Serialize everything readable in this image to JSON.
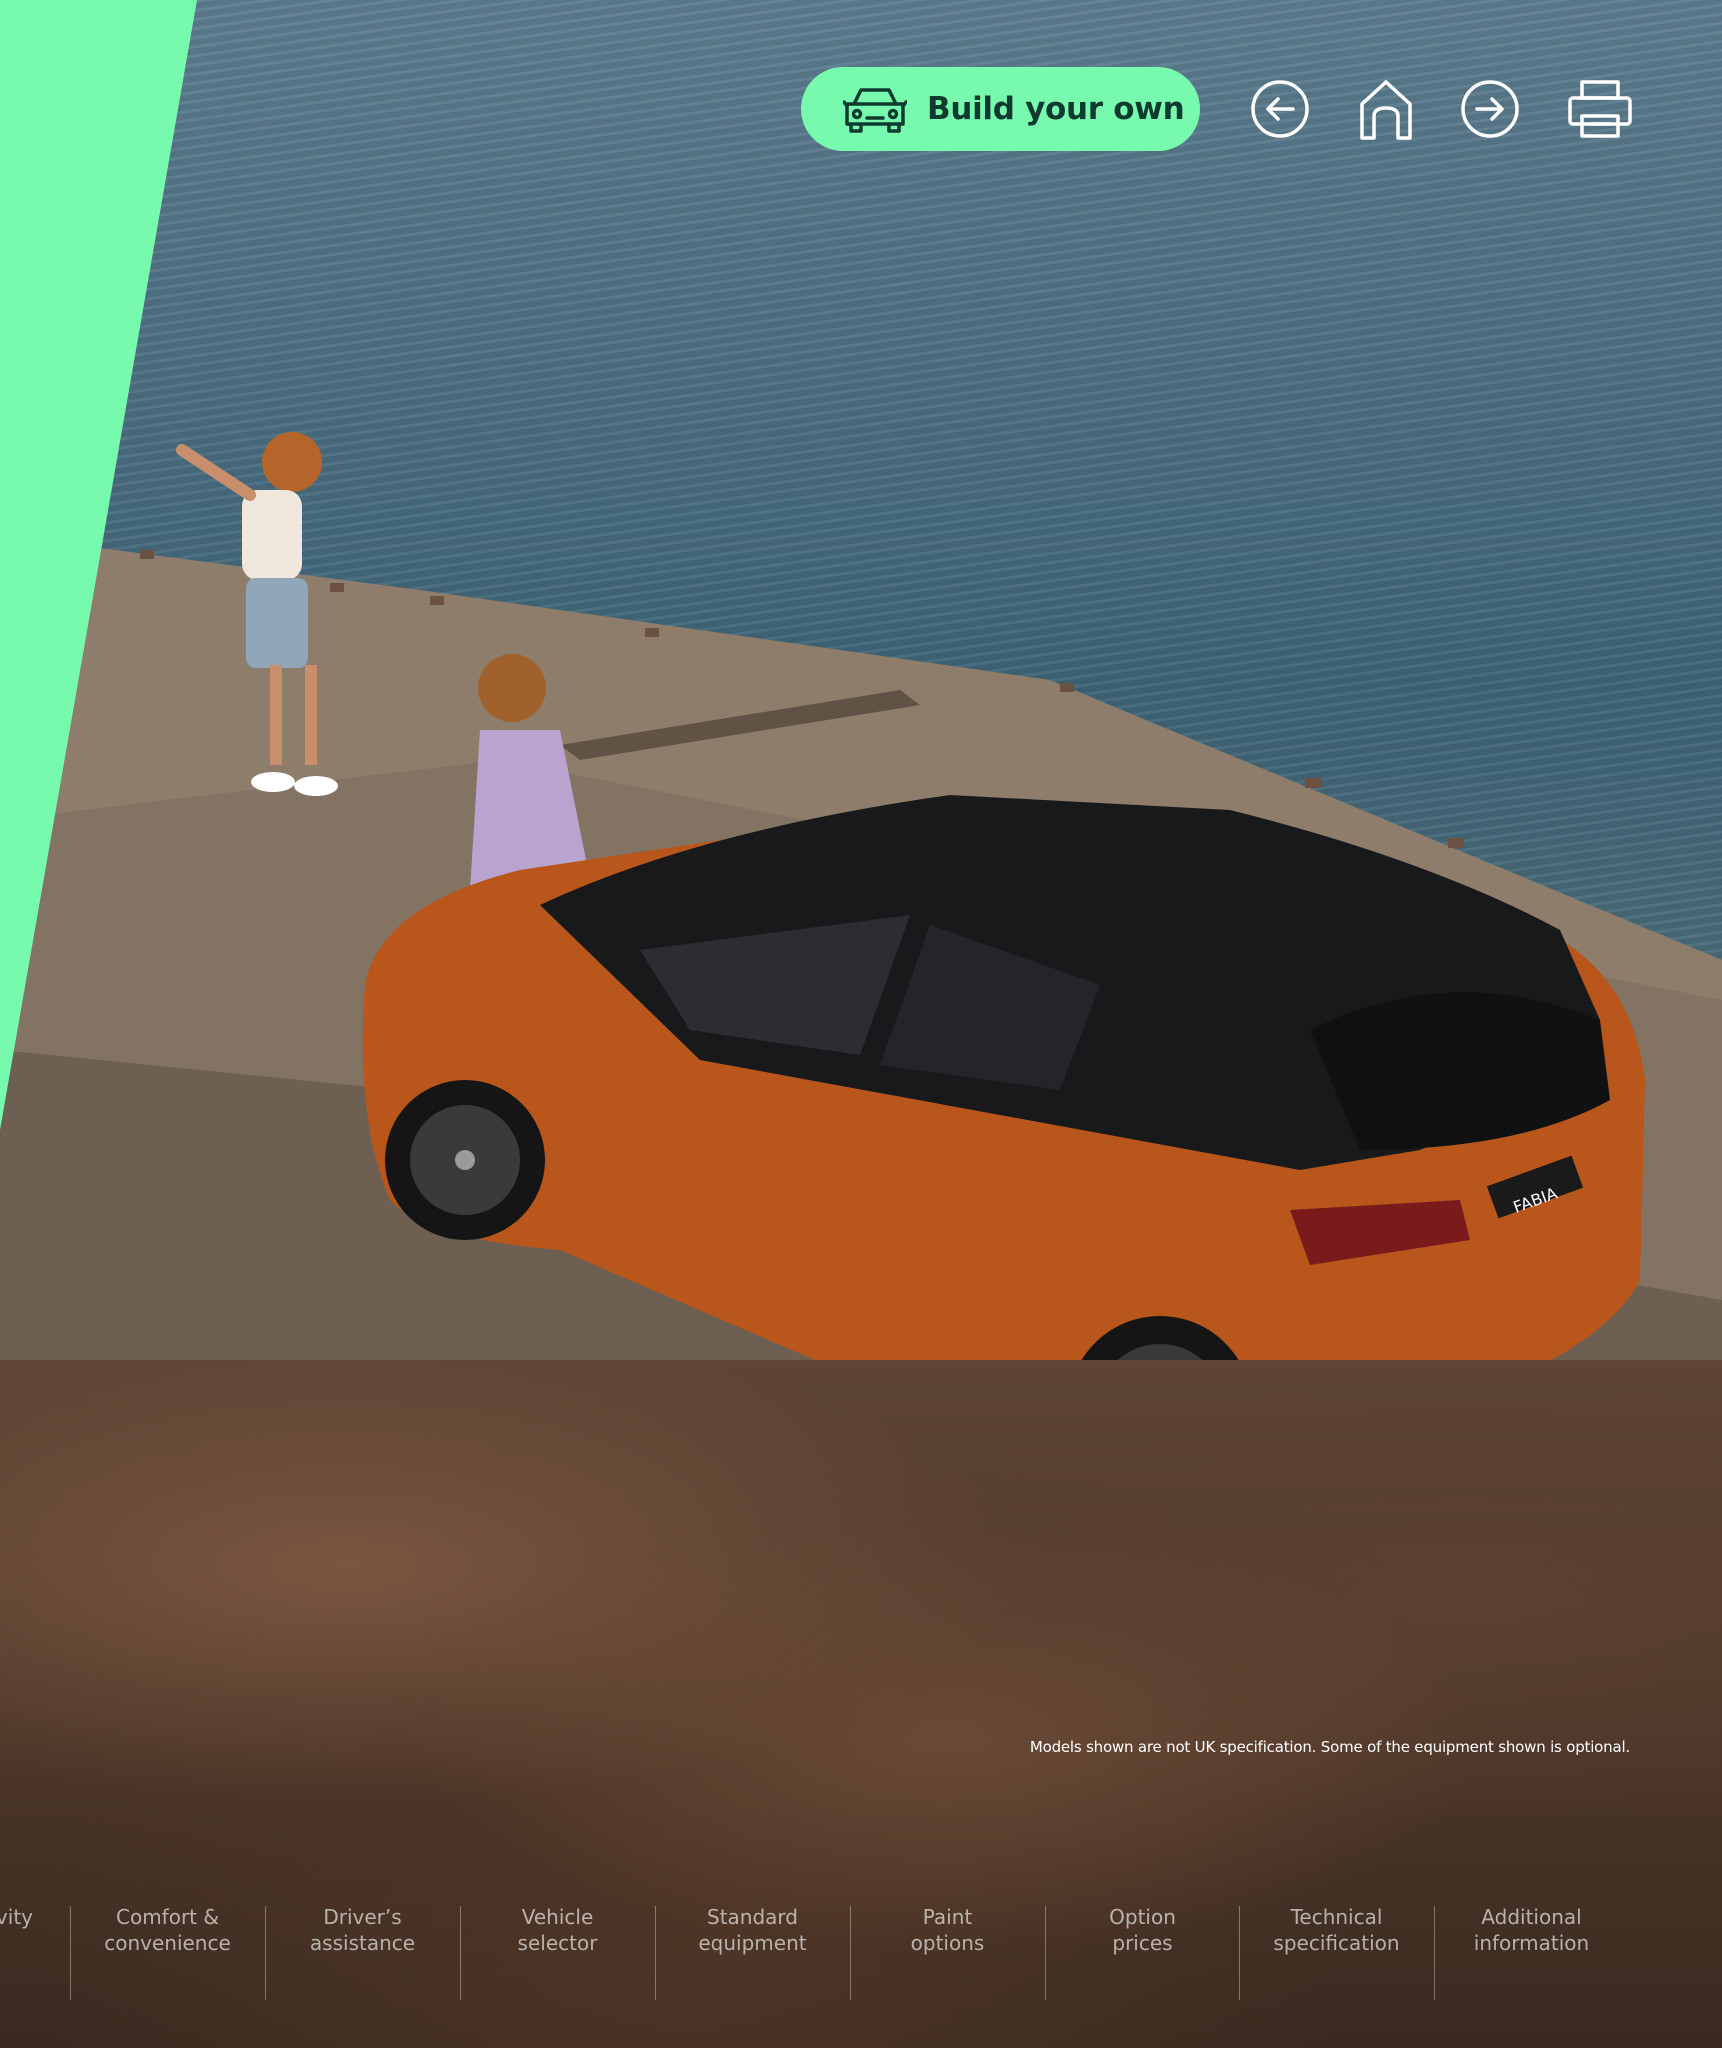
{
  "toolbar": {
    "build_label": "Build your own",
    "icons": [
      "car-icon",
      "back-arrow-icon",
      "home-icon",
      "forward-arrow-icon",
      "print-icon"
    ]
  },
  "colors": {
    "accent": "#78faae",
    "button_text": "#0e3a2f",
    "car": "#b8561c",
    "sea": "#4c6f81"
  },
  "disclaimer": "Models shown are not UK specification. Some of the equipment shown is optional.",
  "bottom_nav": {
    "items": [
      {
        "line1": "vity",
        "line2": ""
      },
      {
        "line1": "Comfort &",
        "line2": "convenience"
      },
      {
        "line1": "Driver’s",
        "line2": "assistance"
      },
      {
        "line1": "Vehicle",
        "line2": "selector"
      },
      {
        "line1": "Standard",
        "line2": "equipment"
      },
      {
        "line1": "Paint",
        "line2": "options"
      },
      {
        "line1": "Option",
        "line2": "prices"
      },
      {
        "line1": "Technical",
        "line2": "specification"
      },
      {
        "line1": "Additional",
        "line2": "information"
      }
    ]
  },
  "car_badge": "FABIA"
}
